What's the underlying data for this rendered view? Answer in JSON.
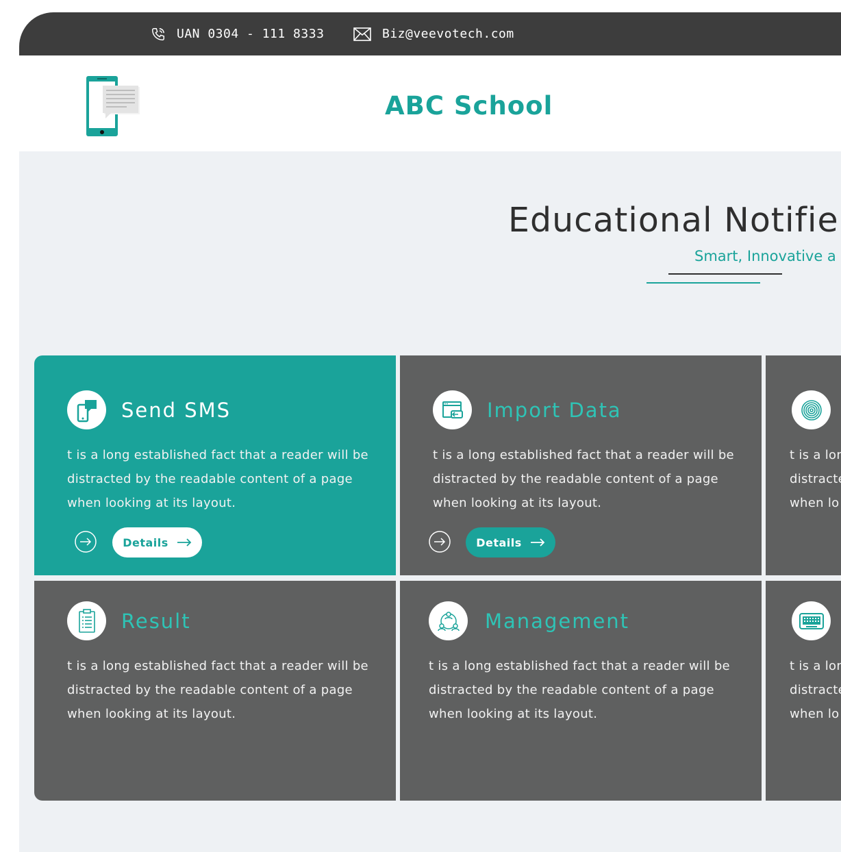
{
  "topbar": {
    "phone_icon": "phone-icon",
    "phone": "UAN 0304 - 111 8333",
    "email_icon": "envelope-icon",
    "email": "Biz@veevotech.com"
  },
  "header": {
    "logo_icon": "phone-sms-logo",
    "school_name": "ABC School"
  },
  "hero": {
    "title": "Educational Notifier",
    "subtitle": "Smart, Innovative a"
  },
  "cards": [
    {
      "icon": "sms-phone-icon",
      "title": "Send SMS",
      "description": "t is a long established fact that a reader will be\ndistracted by the readable content of a page\n when looking at its layout.",
      "button_label": "Details"
    },
    {
      "icon": "import-window-icon",
      "title": "Import Data",
      "description": "t is a long established fact that a reader will be\ndistracted by the readable content of a page\n when looking at its layout.",
      "button_label": "Details"
    },
    {
      "icon": "fingerprint-icon",
      "description": "t is a lon\ndistracte\n when lo"
    },
    {
      "icon": "clipboard-icon",
      "title": "Result",
      "description": "t is a long established fact that a reader will be\ndistracted by the readable content of a page\n when looking at its layout."
    },
    {
      "icon": "network-people-icon",
      "title": "Management",
      "description": "t is a long established fact that a reader will be\ndistracted by the readable content of a page\n when looking at its layout."
    },
    {
      "icon": "keyboard-icon",
      "description": "t is a lon\ndistracte\n when lo"
    }
  ],
  "colors": {
    "accent": "#1aa39a",
    "card_grey": "#5f6060",
    "topbar": "#3d3d3d",
    "background": "#eef1f4"
  }
}
